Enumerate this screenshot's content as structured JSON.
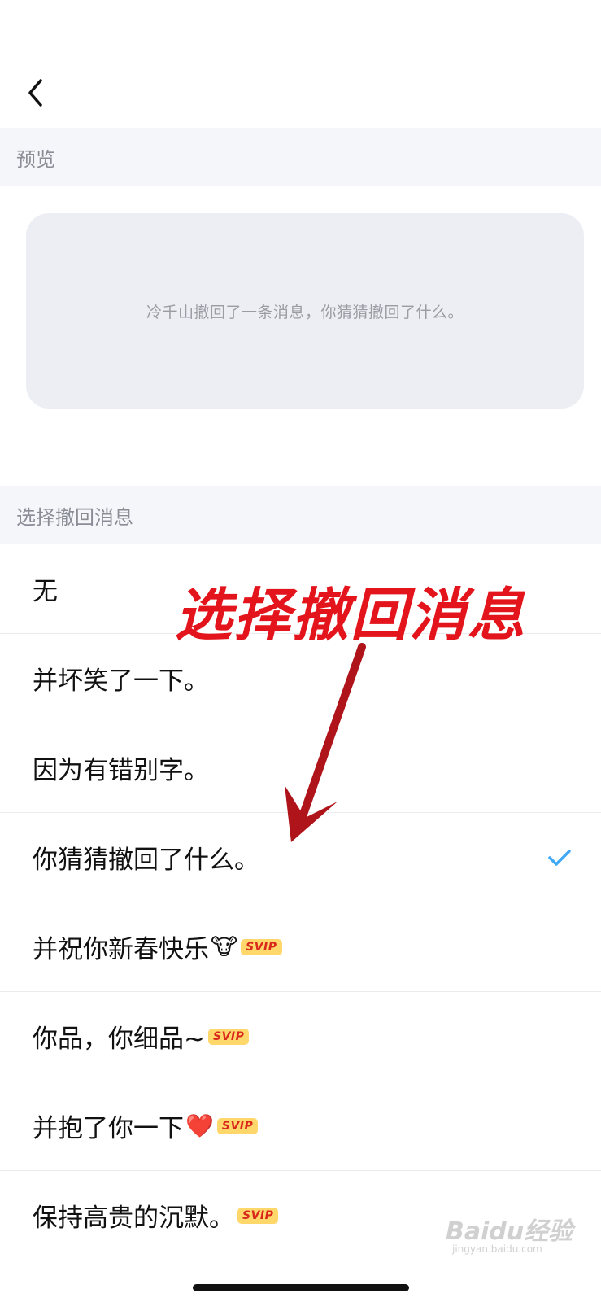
{
  "header": {
    "back_icon": "chevron-left-icon"
  },
  "preview_section": {
    "title": "预览",
    "message": "冷千山撤回了一条消息，你猜猜撤回了什么。"
  },
  "select_section": {
    "title": "选择撤回消息",
    "options": [
      {
        "label": "无",
        "emoji": "",
        "badge": "",
        "selected": false
      },
      {
        "label": "并坏笑了一下。",
        "emoji": "",
        "badge": "",
        "selected": false
      },
      {
        "label": "因为有错别字。",
        "emoji": "",
        "badge": "",
        "selected": false
      },
      {
        "label": "你猜猜撤回了什么。",
        "emoji": "",
        "badge": "",
        "selected": true
      },
      {
        "label": "并祝你新春快乐",
        "emoji": "🐮",
        "badge": "SVIP",
        "selected": false
      },
      {
        "label": "你品，你细品~",
        "emoji": "",
        "badge": "SVIP",
        "selected": false
      },
      {
        "label": "并抱了你一下",
        "emoji": "❤️",
        "badge": "SVIP",
        "selected": false
      },
      {
        "label": "保持高贵的沉默。",
        "emoji": "",
        "badge": "SVIP",
        "selected": false
      }
    ]
  },
  "annotation": {
    "text": "选择撤回消息",
    "color": "#e3141b",
    "arrow_color": "#b0141b"
  },
  "watermark": {
    "text": "Baidu经验",
    "sub": "jingyan.baidu.com"
  },
  "colors": {
    "check": "#3fa9f5",
    "svip_bg": "#ffd76b",
    "svip_text": "#d9271c",
    "section_bg": "#f5f6fa"
  }
}
